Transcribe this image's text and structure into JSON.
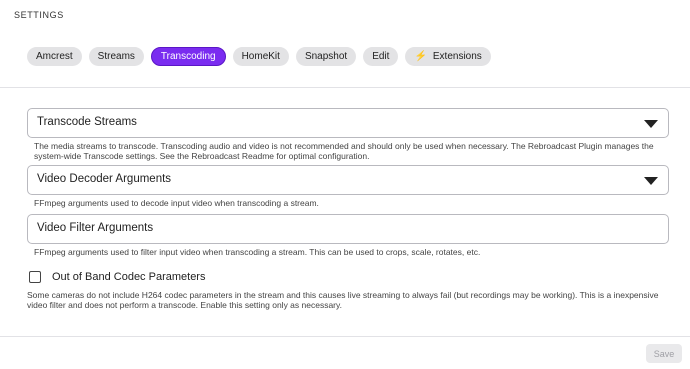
{
  "header": {
    "title": "SETTINGS"
  },
  "tabs": [
    {
      "label": "Amcrest",
      "icon": ""
    },
    {
      "label": "Streams",
      "icon": ""
    },
    {
      "label": "Transcoding",
      "icon": "",
      "active": true
    },
    {
      "label": "HomeKit",
      "icon": ""
    },
    {
      "label": "Snapshot",
      "icon": ""
    },
    {
      "label": "Edit",
      "icon": ""
    },
    {
      "label": "Extensions",
      "icon": "⚡"
    }
  ],
  "fields": {
    "transcode_streams": {
      "label": "Transcode Streams",
      "help": "The media streams to transcode. Transcoding audio and video is not recommended and should only be used when necessary. The Rebroadcast Plugin manages the system-wide Transcode settings. See the Rebroadcast Readme for optimal configuration."
    },
    "video_decoder": {
      "label": "Video Decoder Arguments",
      "help": "FFmpeg arguments used to decode input video when transcoding a stream."
    },
    "video_filter": {
      "label": "Video Filter Arguments",
      "help": "FFmpeg arguments used to filter input video when transcoding a stream. This can be used to crops, scale, rotates, etc."
    },
    "out_of_band": {
      "label": "Out of Band Codec Parameters",
      "help": "Some cameras do not include H264 codec parameters in the stream and this causes live streaming to always fail (but recordings may be working). This is a inexpensive video filter and does not perform a transcode. Enable this setting only as necessary."
    }
  },
  "footer": {
    "save_label": "Save"
  }
}
